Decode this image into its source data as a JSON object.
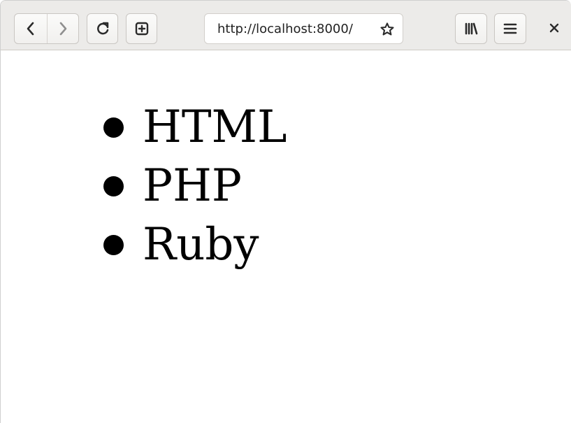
{
  "browser": {
    "url": "http://localhost:8000/",
    "icons": {
      "back": "back-arrow-icon",
      "forward": "forward-arrow-icon",
      "reload": "reload-icon",
      "new_tab": "new-tab-icon",
      "bookmark": "star-icon",
      "library": "library-icon",
      "menu": "menu-icon",
      "close": "close-icon"
    },
    "colors": {
      "toolbar_background": "#ecebe9",
      "page_background": "#ffffff",
      "text": "#000000"
    }
  },
  "page": {
    "list_items": [
      "HTML",
      "PHP",
      "Ruby"
    ]
  }
}
